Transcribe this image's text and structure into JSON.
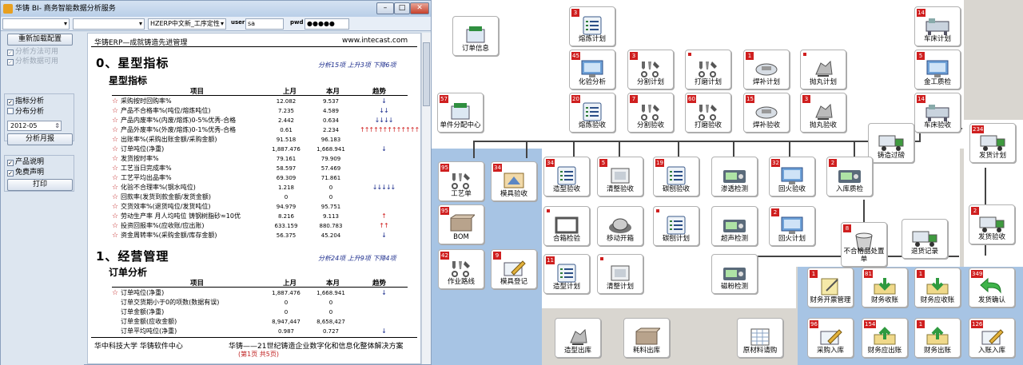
{
  "window": {
    "title": "华铸 BI- 商务智能数据分析服务",
    "min": "–",
    "max": "□",
    "close": "✕"
  },
  "toolbar": {
    "combo1": "",
    "combo2": "",
    "combo3": "HZERP中文新_工序定性",
    "user_label": "user",
    "user_value": "sa",
    "pwd_label": "pwd",
    "pwd_value": "●●●●●"
  },
  "left": {
    "reload": "重新加载配置",
    "chk_method": "分析方法可用",
    "chk_data": "分析数据可用",
    "chk_indicator": "指标分析",
    "chk_distribution": "分布分析",
    "date": "2012-05",
    "monthly": "分析月报",
    "chk_explain": "产品说明",
    "chk_disclaimer": "免费声明",
    "print": "打印"
  },
  "report": {
    "header_left": "华铸ERP—成就铸造先进管理",
    "header_right": "www.intecast.com",
    "section0_title": "0、星型指标",
    "section0_summary": "分析15项 上升3项 下降6项",
    "sub0_title": "星型指标",
    "col_item": "项目",
    "col_last": "上月",
    "col_this": "本月",
    "col_trend": "趋势",
    "rows0": [
      {
        "name": "采购按时回购率%",
        "last": "12.082",
        "this": "9.537",
        "trend": "↓",
        "red": false
      },
      {
        "name": "产品不合格率%(吨位/熔炼吨位)",
        "last": "7.235",
        "this": "4.589",
        "trend": "↓↓",
        "red": false
      },
      {
        "name": "产品内废率%(内废/熔炼)0-5%优秀-合格",
        "last": "2.442",
        "this": "0.634",
        "trend": "↓↓↓↓",
        "red": false
      },
      {
        "name": "产品外废率%(外废/熔炼)0-1%优秀-合格",
        "last": "0.61",
        "this": "2.234",
        "trend": "↑↑↑↑↑↑↑↑↑↑↑↑↑",
        "red": true
      },
      {
        "name": "出账率%(采购出账金额/采购金额)",
        "last": "91.518",
        "this": "96.183",
        "trend": "",
        "red": false
      },
      {
        "name": "订单吨位(净重)",
        "last": "1,887.476",
        "this": "1,668.941",
        "trend": "↓",
        "red": false
      },
      {
        "name": "发货按时率%",
        "last": "79.161",
        "this": "79.909",
        "trend": "",
        "red": false
      },
      {
        "name": "工艺当日完成率%",
        "last": "58.597",
        "this": "57.469",
        "trend": "",
        "red": false
      },
      {
        "name": "工艺平均出品率%",
        "last": "69.309",
        "this": "71.861",
        "trend": "",
        "red": false
      },
      {
        "name": "化验不合理率%(钢水吨位)",
        "last": "1.218",
        "this": "0",
        "trend": "↓↓↓↓↓",
        "red": false
      },
      {
        "name": "回款率(发货到款金额/发货金额)",
        "last": "0",
        "this": "0",
        "trend": "",
        "red": false
      },
      {
        "name": "交货效率%(退货吨位/发货吨位)",
        "last": "94.979",
        "this": "95.751",
        "trend": "",
        "red": false
      },
      {
        "name": "劳动生产率 月人均吨位 铸钢树脂砂≈10优",
        "last": "8.216",
        "this": "9.113",
        "trend": "↑",
        "red": true
      },
      {
        "name": "投资回报率%(应收账/应出账)",
        "last": "633.159",
        "this": "880.783",
        "trend": "↑↑",
        "red": true
      },
      {
        "name": "资金周转率%(采购金额/库存金额)",
        "last": "56.375",
        "this": "45.204",
        "trend": "↓",
        "red": false
      }
    ],
    "section1_title": "1、经营管理",
    "section1_summary": "分析24项 上升9项 下降4项",
    "sub1_title": "订单分析",
    "rows1": [
      {
        "name": "订单吨位(净重)",
        "last": "1,887.476",
        "this": "1,668.941",
        "trend": "↓",
        "red": false,
        "star": true
      },
      {
        "name": "订单交货期小于0的项数(数据有误)",
        "last": "0",
        "this": "0",
        "trend": "",
        "red": false,
        "star": false
      },
      {
        "name": "订单金额(净重)",
        "last": "0",
        "this": "0",
        "trend": "",
        "red": false,
        "star": false
      },
      {
        "name": "订单金额(应收金额)",
        "last": "8,947,447",
        "this": "8,658,427",
        "trend": "",
        "red": false,
        "star": false
      },
      {
        "name": "订单平均吨位(净重)",
        "last": "0.987",
        "this": "0.727",
        "trend": "↓",
        "red": false,
        "star": false
      }
    ],
    "footer_left": "华中科技大学 华铸软件中心",
    "footer_right": "华铸——21世纪铸造企业数字化和信息化整体解决方案",
    "footer_page": "(第1页 共5页)"
  },
  "flow": {
    "nodes": [
      {
        "id": "order-info",
        "label": "订单信息",
        "badge": "",
        "dot": false,
        "icon": "order-icon"
      },
      {
        "id": "melt-plan",
        "label": "熔炼计划",
        "badge": "3",
        "dot": false,
        "icon": "list-icon"
      },
      {
        "id": "lathe-plan",
        "label": "车床计划",
        "badge": "14",
        "dot": false,
        "icon": "lathe-icon"
      },
      {
        "id": "lab-analysis",
        "label": "化验分析",
        "badge": "45",
        "dot": false,
        "icon": "monitor-icon"
      },
      {
        "id": "cut-plan",
        "label": "分割计划",
        "badge": "3",
        "dot": false,
        "icon": "tools-icon"
      },
      {
        "id": "grind-plan",
        "label": "打磨计划",
        "badge": "",
        "dot": true,
        "icon": "tools-icon"
      },
      {
        "id": "weld-plan",
        "label": "焊补计划",
        "badge": "1",
        "dot": false,
        "icon": "weld-icon"
      },
      {
        "id": "blast-plan",
        "label": "抛丸计划",
        "badge": "",
        "dot": true,
        "icon": "blast-icon"
      },
      {
        "id": "metal-inspect",
        "label": "金工质检",
        "badge": "5",
        "dot": false,
        "icon": "monitor-icon"
      },
      {
        "id": "job-dispatch",
        "label": "单件分配中心",
        "badge": "57",
        "dot": false,
        "icon": "order-icon"
      },
      {
        "id": "melt-check",
        "label": "熔炼验收",
        "badge": "20",
        "dot": false,
        "icon": "list-icon"
      },
      {
        "id": "cut-check",
        "label": "分割验收",
        "badge": "7",
        "dot": false,
        "icon": "tools-icon"
      },
      {
        "id": "grind-check",
        "label": "打磨验收",
        "badge": "60",
        "dot": false,
        "icon": "tools-icon"
      },
      {
        "id": "weld-check",
        "label": "焊补验收",
        "badge": "15",
        "dot": false,
        "icon": "weld-icon"
      },
      {
        "id": "blast-check",
        "label": "抛丸验收",
        "badge": "3",
        "dot": false,
        "icon": "blast-icon"
      },
      {
        "id": "lathe-check",
        "label": "车床验收",
        "badge": "14",
        "dot": false,
        "icon": "lathe-icon"
      },
      {
        "id": "cast-transfer",
        "label": "铸造过磅",
        "badge": "",
        "dot": false,
        "icon": "truck-icon"
      },
      {
        "id": "ship-plan",
        "label": "发货计划",
        "badge": "234",
        "dot": false,
        "icon": "truck-icon"
      },
      {
        "id": "process-sheet",
        "label": "工艺单",
        "badge": "95",
        "dot": false,
        "icon": "tools-icon"
      },
      {
        "id": "pattern-check",
        "label": "模具验收",
        "badge": "34",
        "dot": false,
        "icon": "pattern-icon"
      },
      {
        "id": "mold-check",
        "label": "造型验收",
        "badge": "34",
        "dot": false,
        "icon": "list-icon"
      },
      {
        "id": "clean-check",
        "label": "清整验收",
        "badge": "5",
        "dot": false,
        "icon": "box-icon"
      },
      {
        "id": "carbon-check",
        "label": "碳刨验收",
        "badge": "19",
        "dot": false,
        "icon": "list-icon"
      },
      {
        "id": "pen-test",
        "label": "渗透检测",
        "badge": "",
        "dot": false,
        "icon": "device-icon"
      },
      {
        "id": "temper-check",
        "label": "回火验收",
        "badge": "32",
        "dot": false,
        "icon": "monitor-icon"
      },
      {
        "id": "stock-in-inspect",
        "label": "入库质检",
        "badge": "2",
        "dot": false,
        "icon": "device-icon"
      },
      {
        "id": "bom",
        "label": "BOM",
        "badge": "95",
        "dot": false,
        "icon": "bom-icon"
      },
      {
        "id": "box-check",
        "label": "合箱检验",
        "badge": "",
        "dot": true,
        "icon": "frame-icon"
      },
      {
        "id": "move-box",
        "label": "移动开箱",
        "badge": "",
        "dot": false,
        "icon": "helmet-icon"
      },
      {
        "id": "carbon-plan",
        "label": "碳刨计划",
        "badge": "",
        "dot": true,
        "icon": "list-icon"
      },
      {
        "id": "ultra-test",
        "label": "超声检测",
        "badge": "",
        "dot": false,
        "icon": "device-icon"
      },
      {
        "id": "temper-plan",
        "label": "回火计划",
        "badge": "2",
        "dot": false,
        "icon": "monitor-icon"
      },
      {
        "id": "nonconform",
        "label": "不合格品处置单",
        "badge": "8",
        "dot": false,
        "icon": "bin-icon"
      },
      {
        "id": "return-record",
        "label": "退货记录",
        "badge": "",
        "dot": false,
        "icon": "truck-icon"
      },
      {
        "id": "ship-check",
        "label": "发货验收",
        "badge": "2",
        "dot": false,
        "icon": "truck-icon"
      },
      {
        "id": "route",
        "label": "作业路线",
        "badge": "42",
        "dot": false,
        "icon": "tools-icon"
      },
      {
        "id": "pattern-register",
        "label": "模具登记",
        "badge": "9",
        "dot": false,
        "icon": "pen-icon"
      },
      {
        "id": "mold-plan",
        "label": "造型计划",
        "badge": "11",
        "dot": false,
        "icon": "list-icon"
      },
      {
        "id": "clean-plan",
        "label": "清整计划",
        "badge": "",
        "dot": true,
        "icon": "box-icon"
      },
      {
        "id": "mag-test",
        "label": "磁粉检测",
        "badge": "",
        "dot": false,
        "icon": "device-icon"
      },
      {
        "id": "fin-invoice",
        "label": "财务开票管理",
        "badge": "1",
        "dot": false,
        "icon": "note-icon"
      },
      {
        "id": "fin-recv",
        "label": "财务收账",
        "badge": "81",
        "dot": false,
        "icon": "arrowdown-icon"
      },
      {
        "id": "fin-recv-ar",
        "label": "财务应收账",
        "badge": "1",
        "dot": false,
        "icon": "arrowdown-icon"
      },
      {
        "id": "ship-confirm",
        "label": "发货确认",
        "badge": "349",
        "dot": false,
        "icon": "back-icon"
      },
      {
        "id": "mold-out",
        "label": "造型出库",
        "badge": "",
        "dot": false,
        "icon": "blast-icon"
      },
      {
        "id": "material-out",
        "label": "耗料出库",
        "badge": "",
        "dot": false,
        "icon": "bom-icon"
      },
      {
        "id": "raw-purchase",
        "label": "原材料请购",
        "badge": "",
        "dot": false,
        "icon": "sheet-icon"
      },
      {
        "id": "purchase-in",
        "label": "采购入库",
        "badge": "96",
        "dot": false,
        "icon": "pen-icon"
      },
      {
        "id": "fin-pay-out",
        "label": "财务应出账",
        "badge": "154",
        "dot": false,
        "icon": "arrowup-icon"
      },
      {
        "id": "fin-out",
        "label": "财务出账",
        "badge": "1",
        "dot": false,
        "icon": "arrowup-icon"
      },
      {
        "id": "account-in",
        "label": "入账入库",
        "badge": "126",
        "dot": false,
        "icon": "pen-icon"
      }
    ]
  }
}
